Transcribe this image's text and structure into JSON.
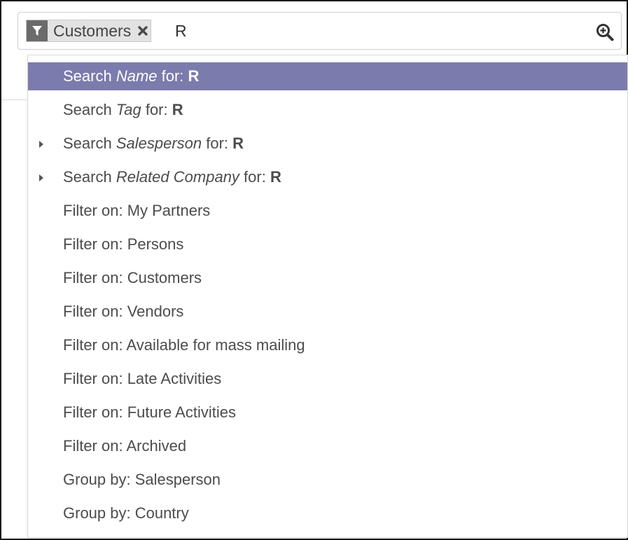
{
  "search": {
    "facet_label": "Customers",
    "input_value": "R"
  },
  "autocomplete": [
    {
      "prefix": "Search ",
      "field": "Name",
      "middle": " for: ",
      "term": "R",
      "expandable": false,
      "active": true
    },
    {
      "prefix": "Search ",
      "field": "Tag",
      "middle": " for: ",
      "term": "R",
      "expandable": false,
      "active": false
    },
    {
      "prefix": "Search ",
      "field": "Salesperson",
      "middle": " for: ",
      "term": "R",
      "expandable": true,
      "active": false
    },
    {
      "prefix": "Search ",
      "field": "Related Company",
      "middle": " for: ",
      "term": "R",
      "expandable": true,
      "active": false
    }
  ],
  "filters": [
    "Filter on: My Partners",
    "Filter on: Persons",
    "Filter on: Customers",
    "Filter on: Vendors",
    "Filter on: Available for mass mailing",
    "Filter on: Late Activities",
    "Filter on: Future Activities",
    "Filter on: Archived"
  ],
  "group_by": [
    "Group by: Salesperson",
    "Group by: Country"
  ],
  "colors": {
    "active_row": "#7c7bad",
    "facet_icon_bg": "#6b6b6b",
    "facet_bg": "#e2e2e2"
  }
}
